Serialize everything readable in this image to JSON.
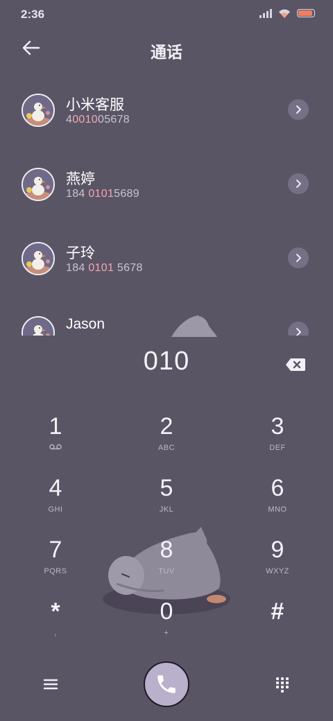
{
  "status_bar": {
    "time": "2:36",
    "battery_level": 0.9,
    "battery_color": "#f07e64",
    "icons": [
      "signal-icon",
      "wifi-icon",
      "battery-icon"
    ]
  },
  "header": {
    "title": "通话",
    "back_icon": "arrow-left-icon"
  },
  "contacts": [
    {
      "name": "小米客服",
      "number_parts": [
        "4",
        "0010",
        "05678"
      ]
    },
    {
      "name": "燕婷",
      "number_parts": [
        "184 ",
        "0101",
        "5689"
      ]
    },
    {
      "name": "子玲",
      "number_parts": [
        "184 ",
        "0101",
        " 5678"
      ]
    },
    {
      "name": "Jason",
      "number_parts": [
        "",
        "",
        ""
      ]
    }
  ],
  "dialer": {
    "input": "010",
    "backspace_icon": "backspace-icon"
  },
  "keypad": [
    {
      "digit": "1",
      "letters": "",
      "icon": "voicemail-icon"
    },
    {
      "digit": "2",
      "letters": "ABC"
    },
    {
      "digit": "3",
      "letters": "DEF"
    },
    {
      "digit": "4",
      "letters": "GHI"
    },
    {
      "digit": "5",
      "letters": "JKL"
    },
    {
      "digit": "6",
      "letters": "MNO"
    },
    {
      "digit": "7",
      "letters": "PQRS"
    },
    {
      "digit": "8",
      "letters": "TUV"
    },
    {
      "digit": "9",
      "letters": "WXYZ"
    },
    {
      "digit": "*",
      "letters": ","
    },
    {
      "digit": "0",
      "letters": "+"
    },
    {
      "digit": "#",
      "letters": ""
    }
  ],
  "bottom_bar": {
    "menu_icon": "menu-icon",
    "call_icon": "phone-icon",
    "dialpad_icon": "dialpad-icon"
  },
  "colors": {
    "background": "#595565",
    "highlight": "#f5a6b2",
    "call_button": "#b9b0cc"
  }
}
